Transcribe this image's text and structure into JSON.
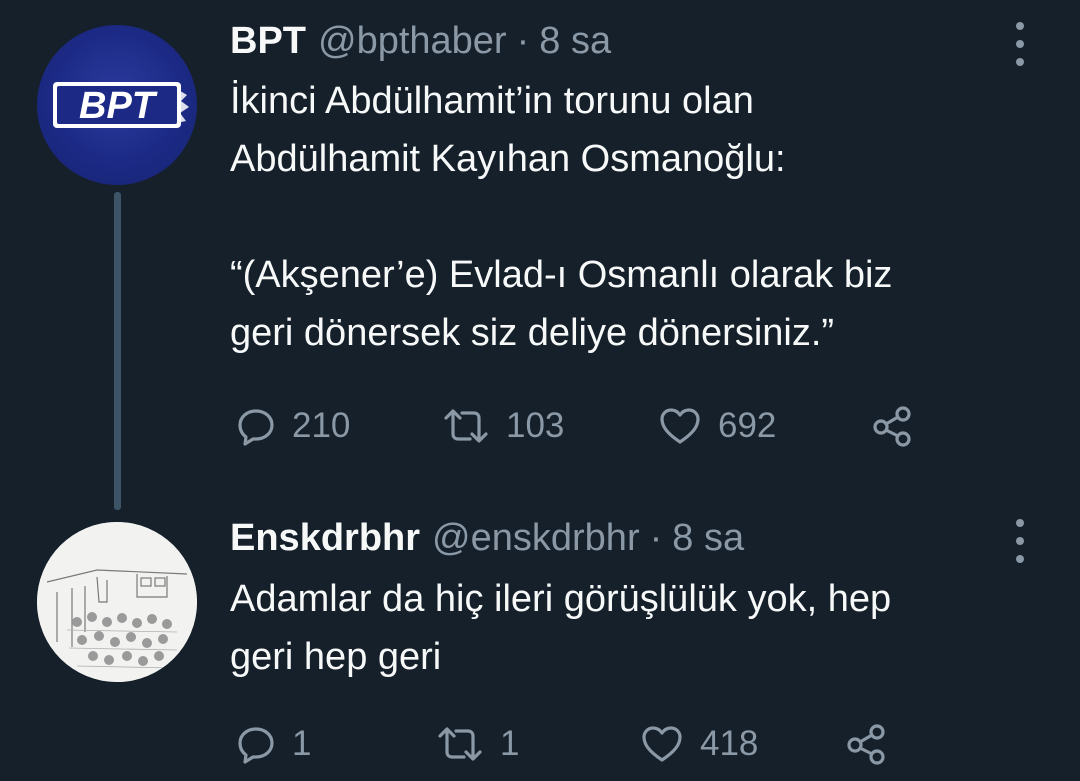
{
  "tweets": [
    {
      "name": "BPT",
      "handle": "@bpthaber",
      "separator": "·",
      "time": "8 sa",
      "avatar_text": "BPT",
      "lines": [
        "İkinci Abdülhamit’in torunu olan",
        "Abdülhamit Kayıhan Osmanoğlu:",
        "",
        "“(Akşener’e) Evlad-ı Osmanlı olarak biz",
        "geri dönersek siz deliye dönersiniz.”"
      ],
      "replies": "210",
      "retweets": "103",
      "likes": "692"
    },
    {
      "name": "Enskdrbhr",
      "handle": "@enskdrbhr",
      "separator": "·",
      "time": "8 sa",
      "lines": [
        "Adamlar da hiç ileri görüşlülük yok, hep",
        "geri hep geri"
      ],
      "replies": "1",
      "retweets": "1",
      "likes": "418"
    }
  ],
  "icons": {
    "reply": "reply-icon",
    "retweet": "retweet-icon",
    "like": "heart-icon",
    "share": "share-icon",
    "more": "more-options-icon"
  },
  "colors": {
    "background": "#15202b",
    "text_primary": "#f7f9f9",
    "text_secondary": "#8b98a5",
    "thread_line": "#3d5466",
    "bpt_avatar_bg": "#1c2a86"
  }
}
